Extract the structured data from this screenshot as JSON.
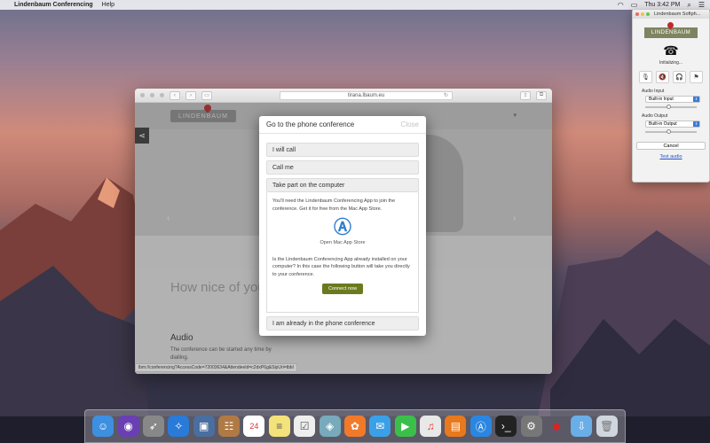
{
  "menubar": {
    "app_name": "Lindenbaum Conferencing",
    "help": "Help",
    "clock": "Thu 3:42 PM"
  },
  "browser": {
    "url": "tirana.lbaum.eu",
    "site_logo": "LINDENBAUM",
    "hero_text": "How nice of you",
    "audio_heading": "Audio",
    "audio_text": "The conference can be started any time by dialling.",
    "status_url": "lbm://conferencing?AccessCode=72003634&AttendeeId=c2dxP6g&SipUri=tbbl"
  },
  "modal": {
    "title": "Go to the phone conference",
    "close": "Close",
    "options": {
      "will_call": "I will call",
      "call_me": "Call me",
      "computer": "Take part on the computer",
      "already": "I am already in the phone conference"
    },
    "panel_text": "You'll need the Lindenbaum Conferencing App to join the conference. Get it for free from the Mac App Store.",
    "store_label": "Open Mac App Store",
    "installed_text": "Is the Lindenbaum Conferencing App already installed on your computer? In this case the following button will take you directly to your conference.",
    "connect": "Connect now"
  },
  "softphone": {
    "title": "Lindenbaum Softph...",
    "logo": "LINDENBAUM",
    "status": "Initializing...",
    "audio_input_label": "Audio Input",
    "audio_input": "Built-in Input",
    "audio_output_label": "Audio Output",
    "audio_output": "Built-in Output",
    "cancel": "Cancel",
    "test_audio": "Test audio"
  },
  "dock": {
    "date_icon": "24"
  }
}
